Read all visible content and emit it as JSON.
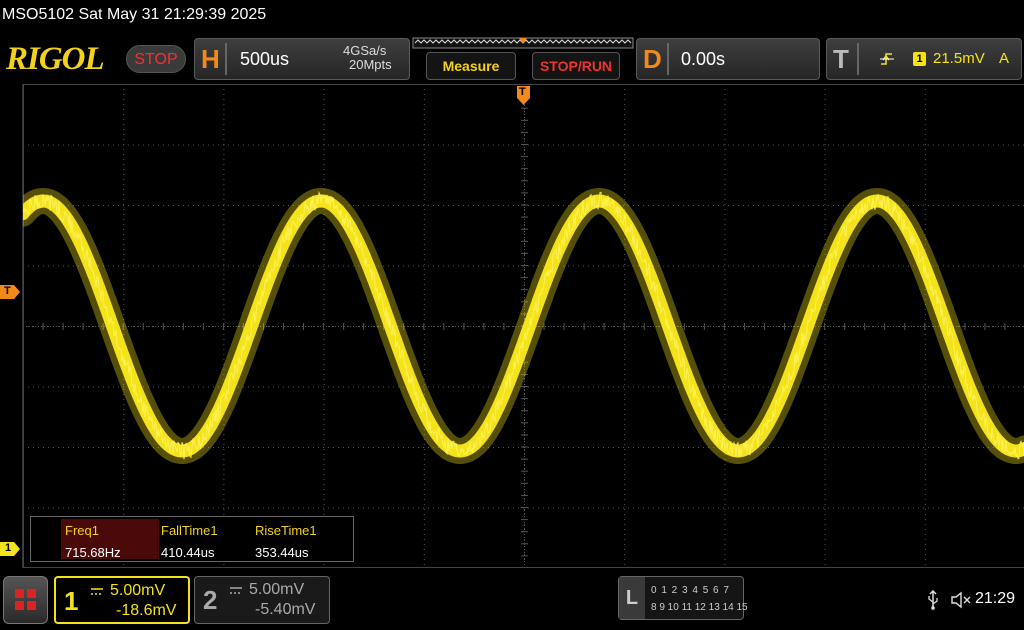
{
  "window": {
    "title": "MSO5102  Sat May 31 21:29:39 2025"
  },
  "topbar": {
    "logo": "RIGOL",
    "run_state": "STOP",
    "horizontal": {
      "letter": "H",
      "timebase": "500us",
      "sample_rate": "4GSa/s",
      "memory_depth": "20Mpts"
    },
    "measure_label": "Measure",
    "stop_run_label": "STOP/RUN",
    "delay": {
      "letter": "D",
      "value": "0.00s"
    },
    "trigger": {
      "letter": "T",
      "source": "1",
      "level": "21.5mV",
      "mode": "A"
    }
  },
  "markers": {
    "trigger_top": "T",
    "trigger_left": "T",
    "channel1_ground": "1"
  },
  "measurements": {
    "items": [
      {
        "name": "Freq1",
        "value": "715.68Hz"
      },
      {
        "name": "FallTime1",
        "value": "410.44us"
      },
      {
        "name": "RiseTime1",
        "value": "353.44us"
      }
    ]
  },
  "channels": {
    "ch1": {
      "number": "1",
      "scale": "5.00mV",
      "offset": "-18.6mV",
      "color": "#f4e21a"
    },
    "ch2": {
      "number": "2",
      "scale": "5.00mV",
      "offset": "-5.40mV",
      "color": "#aaaaaa"
    }
  },
  "logic": {
    "letter": "L",
    "row1": "0 1 2 3  4 5 6 7",
    "row2": "8 9 10 11 12 13 14 15"
  },
  "status": {
    "clock": "21:29"
  },
  "colors": {
    "accent_orange": "#f28a1a",
    "trace_yellow": "#f4e21a",
    "stop_red": "#e33333"
  }
}
